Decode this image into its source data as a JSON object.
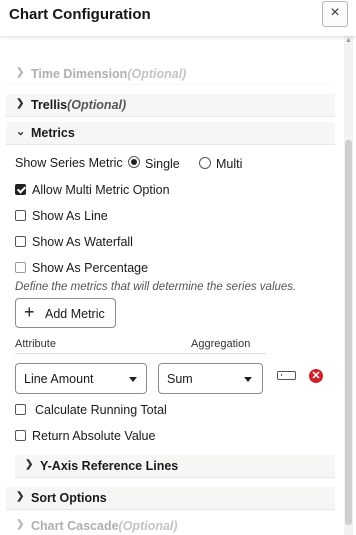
{
  "header": {
    "title": "Chart Configuration",
    "close_label": "×"
  },
  "sections": {
    "time_dimension": {
      "label": "Time Dimension",
      "optional": "(Optional)"
    },
    "trellis": {
      "label": "Trellis",
      "optional": "(Optional)"
    },
    "metrics": {
      "label": "Metrics"
    },
    "y_axis": {
      "label": "Y-Axis Reference Lines"
    },
    "sort": {
      "label": "Sort Options"
    },
    "chart_cascade": {
      "label": "Chart Cascade",
      "optional": "(Optional)"
    }
  },
  "metrics": {
    "show_series_label": "Show Series Metric",
    "radio_single": "Single",
    "radio_multi": "Multi",
    "selected": "Single",
    "allow_multi": {
      "label": "Allow Multi Metric Option",
      "checked": true
    },
    "show_as_line": {
      "label": "Show As Line",
      "checked": false
    },
    "show_as_waterfall": {
      "label": "Show As Waterfall",
      "checked": false
    },
    "show_as_percentage": {
      "label": "Show As Percentage",
      "checked": false
    },
    "hint": "Define the metrics that will determine the series values.",
    "add_metric": "Add Metric",
    "attribute_header": "Attribute",
    "aggregation_header": "Aggregation",
    "attribute_value": "Line Amount",
    "aggregation_value": "Sum",
    "running_total": {
      "label": "Calculate Running Total",
      "checked": false
    },
    "absolute_value": {
      "label": "Return Absolute Value",
      "checked": false
    }
  },
  "icons": [
    "close-icon",
    "chevron-down-icon",
    "chevron-right-icon",
    "plus-icon",
    "caret-down-icon",
    "format-icon",
    "remove-icon"
  ],
  "colors": {
    "remove": "#d0202a",
    "section_bg": "#f6f6f5"
  }
}
